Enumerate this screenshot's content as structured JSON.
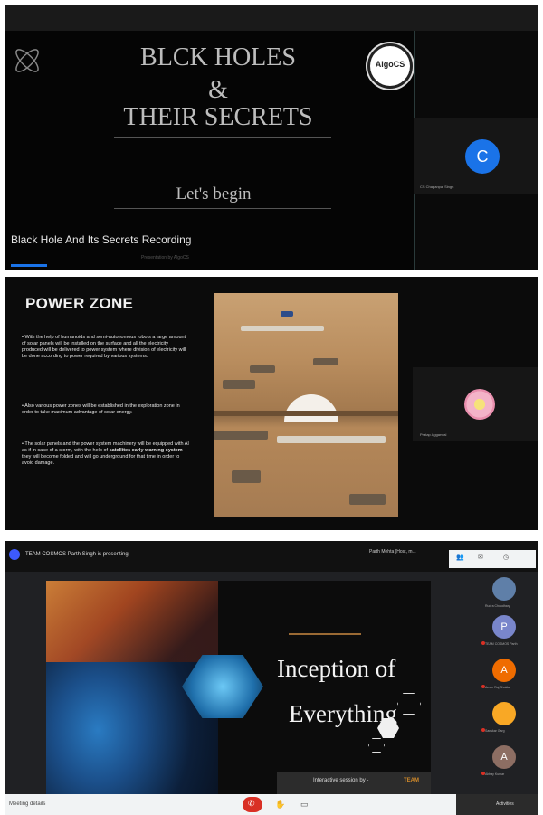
{
  "panel1": {
    "badge": "AlgoCS",
    "title_line1": "BLCK HOLES",
    "title_line2": "&",
    "title_line3": "THEIR SECRETS",
    "subtitle": "Let's begin",
    "recording_label": "Black Hole And Its Secrets Recording",
    "participant_initial": "C",
    "participant_name": "CS Chaganpal Singh",
    "faint_caption": "Presentation by AlgoCS"
  },
  "panel2": {
    "title": "POWER ZONE",
    "bullet1": "With the help of humanoids and semi-autonomous robots a large amount of solar panels will be installed on the surface and all the electricity produced will be delivered to power system where division of electricity will be done according to power required by various systems.",
    "bullet2": "Also various power zones will be established in the exploration zone in order to take maximum advantage of solar energy.",
    "bullet3_pre": "The solar panels and the power system machinery will be equipped with AI as if in case of a storm, with the help of ",
    "bullet3_bold": "satellites early warning system",
    "bullet3_post": " they will become folded and will go underground for that time in order to avoid damage.",
    "participant_name": "Pratap Aggarwal"
  },
  "panel3": {
    "presenting": "TEAM COSMOS Parth Singh is presenting",
    "host": "Parth Mehta (Host, m...",
    "slide_title1": "Inception of",
    "slide_title2": "Everything",
    "banner_text": "Interactive session by -",
    "banner_team": "TEAM",
    "participants": [
      {
        "initial": "",
        "name": "Rudra Choudhary",
        "color": "#5f7fa8"
      },
      {
        "initial": "P",
        "name": "TEAM COSMOS Parth",
        "color": "#7986cb"
      },
      {
        "initial": "A",
        "name": "Aman Raj Shukla",
        "color": "#ef6c00"
      },
      {
        "initial": "",
        "name": "Sanskar Garg",
        "color": "#f9a825"
      },
      {
        "initial": "A",
        "name": "Abhay Kumar",
        "color": "#8d6e63"
      }
    ],
    "bottom_left": "Meeting details",
    "bottom_right": "Activities"
  }
}
